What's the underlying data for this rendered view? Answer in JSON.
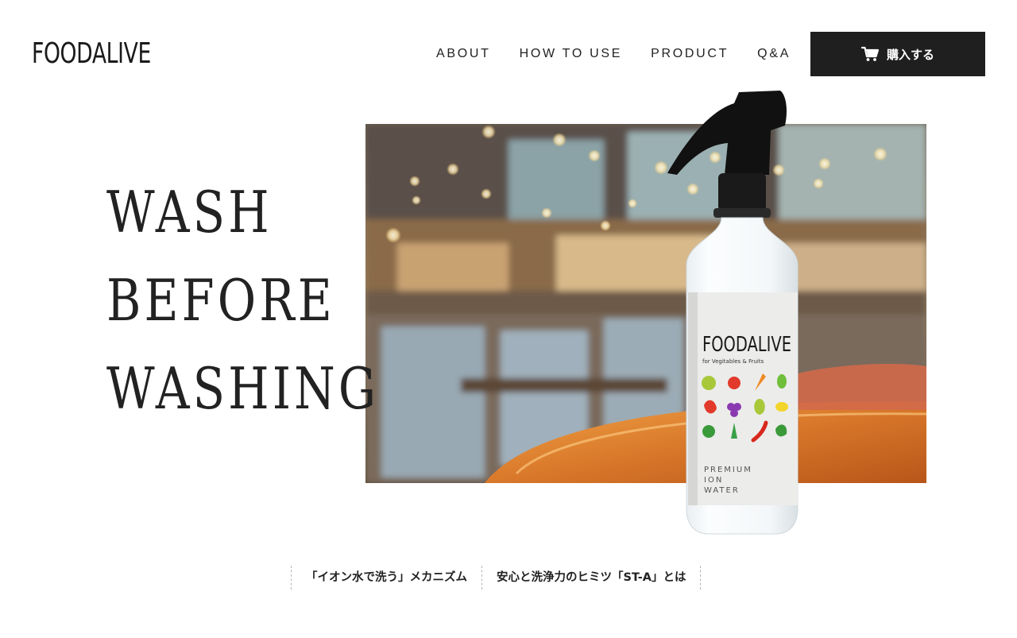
{
  "brand": {
    "logo_text": "FOODALIVE"
  },
  "nav": {
    "items": [
      {
        "label": "ABOUT"
      },
      {
        "label": "HOW TO USE"
      },
      {
        "label": "PRODUCT"
      },
      {
        "label": "Q&A"
      }
    ],
    "buy_button": {
      "label": "購入する",
      "icon": "cart-icon"
    }
  },
  "hero": {
    "title_lines": [
      "WASH",
      "BEFORE",
      "WASHING"
    ],
    "background": "cafe-interior-photo",
    "product": {
      "brand": "FOODALIVE",
      "subtitle": "for Vegitables & Fruits",
      "spec_lines": [
        "PREMIUM",
        "ION",
        "WATER"
      ]
    }
  },
  "sub_links": [
    {
      "label": "「イオン水で洗う」メカニズム"
    },
    {
      "label": "安心と洗浄力のヒミツ「ST-A」とは"
    }
  ],
  "colors": {
    "text": "#222222",
    "button_bg": "#1f1f1f",
    "button_text": "#ffffff",
    "divider": "#b5b5b5"
  }
}
